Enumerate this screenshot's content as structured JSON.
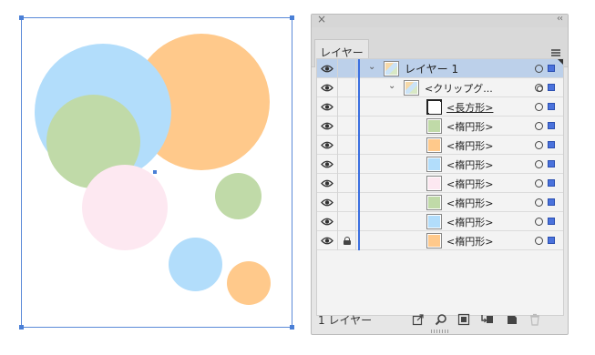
{
  "canvas": {
    "circles": [
      {
        "name": "orange-circle-large",
        "color": "#ffc98b"
      },
      {
        "name": "blue-circle-large",
        "color": "#b2ddfb"
      },
      {
        "name": "green-circle-medium",
        "color": "#c0daa8"
      },
      {
        "name": "pink-circle",
        "color": "#fde8f1"
      },
      {
        "name": "green-circle-small",
        "color": "#c0daa8"
      },
      {
        "name": "blue-circle-small",
        "color": "#b2ddfb"
      },
      {
        "name": "orange-circle-small",
        "color": "#ffc98b"
      }
    ]
  },
  "panel": {
    "close_glyph": "×",
    "collapse_glyph": "‹‹",
    "tab_label": "レイヤー",
    "rows": [
      {
        "label": "レイヤー 1",
        "kind": "layer",
        "selected": true,
        "swatch": "#ffffff",
        "target": "single",
        "underline": false,
        "locked": false
      },
      {
        "label": "<クリップグ...",
        "kind": "group",
        "selected": false,
        "swatch": "#ffffff",
        "target": "double",
        "underline": false,
        "locked": false
      },
      {
        "label": "<長方形>",
        "kind": "item",
        "selected": false,
        "swatch": "#ffffff",
        "target": "single",
        "underline": true,
        "locked": false
      },
      {
        "label": "<楕円形>",
        "kind": "item",
        "selected": false,
        "swatch": "#c0daa8",
        "target": "single",
        "underline": false,
        "locked": false
      },
      {
        "label": "<楕円形>",
        "kind": "item",
        "selected": false,
        "swatch": "#ffc98b",
        "target": "single",
        "underline": false,
        "locked": false
      },
      {
        "label": "<楕円形>",
        "kind": "item",
        "selected": false,
        "swatch": "#b2ddfb",
        "target": "single",
        "underline": false,
        "locked": false
      },
      {
        "label": "<楕円形>",
        "kind": "item",
        "selected": false,
        "swatch": "#fde8f1",
        "target": "single",
        "underline": false,
        "locked": false
      },
      {
        "label": "<楕円形>",
        "kind": "item",
        "selected": false,
        "swatch": "#c0daa8",
        "target": "single",
        "underline": false,
        "locked": false
      },
      {
        "label": "<楕円形>",
        "kind": "item",
        "selected": false,
        "swatch": "#b2ddfb",
        "target": "single",
        "underline": false,
        "locked": false
      },
      {
        "label": "<楕円形>",
        "kind": "item",
        "selected": false,
        "swatch": "#ffc98b",
        "target": "single",
        "underline": false,
        "locked": true
      }
    ],
    "footer_label": "1 レイヤー",
    "footer_icons": [
      "export-icon",
      "locate-object-icon",
      "clipping-mask-icon",
      "new-sublayer-icon",
      "new-layer-icon",
      "trash-icon"
    ],
    "accent_color": "#3b6fe0"
  }
}
